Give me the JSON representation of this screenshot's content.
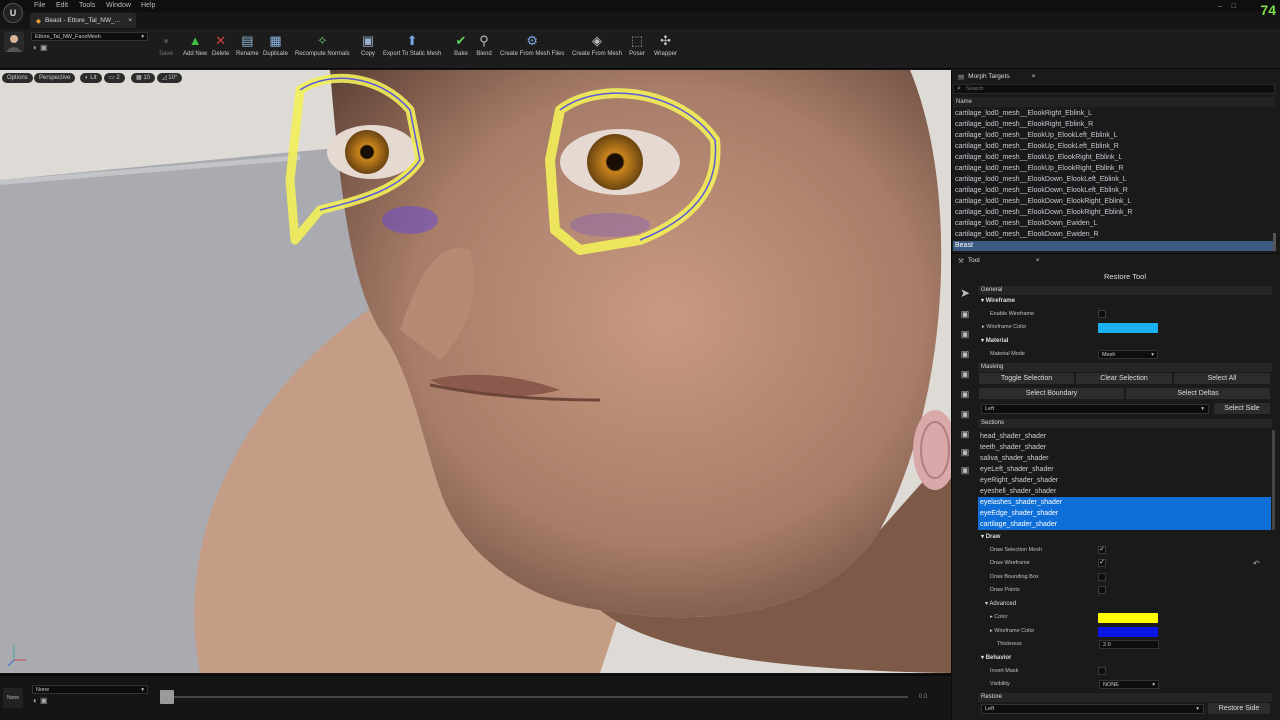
{
  "menu": [
    "File",
    "Edit",
    "Tools",
    "Window",
    "Help"
  ],
  "window": {
    "tab_title": "Beast - Ettore_Tal_NW_...",
    "fps": "74",
    "close": "×"
  },
  "toolbar": {
    "mesh_name": "Ettore_Tal_NW_FaceMesh",
    "buttons": [
      {
        "label": "Save",
        "icon": "▪"
      },
      {
        "label": "Add New",
        "icon": "▲"
      },
      {
        "label": "Delete",
        "icon": "✕"
      },
      {
        "label": "Rename",
        "icon": "▤"
      },
      {
        "label": "Duplicate",
        "icon": "▦"
      },
      {
        "label": "Recompute Normals",
        "icon": "✧"
      },
      {
        "label": "Copy",
        "icon": "▣"
      },
      {
        "label": "Export To Static Mesh",
        "icon": "⬆"
      },
      {
        "label": "Bake",
        "icon": "✔"
      },
      {
        "label": "Blend",
        "icon": "⚲"
      },
      {
        "label": "Create From Mesh Files",
        "icon": "⚙"
      },
      {
        "label": "Create From Mesh",
        "icon": "◈"
      },
      {
        "label": "Poser",
        "icon": "⬚"
      },
      {
        "label": "Wrapper",
        "icon": "✣"
      }
    ]
  },
  "viewport": {
    "options": "Options",
    "perspective": "Perspective",
    "lit": "Lit",
    "cam": "2",
    "grid": "10",
    "angle": "10°"
  },
  "timeline": {
    "track_select": "None",
    "small_label": "None",
    "time": "0.0"
  },
  "morph_panel": {
    "tab": "Morph Targets",
    "search_placeholder": "Search",
    "column": "Name",
    "rows": [
      "cartilage_lod0_mesh__ElookRight_Eblink_L",
      "cartilage_lod0_mesh__ElookRight_Eblink_R",
      "cartilage_lod0_mesh__ElookUp_ElookLeft_Eblink_L",
      "cartilage_lod0_mesh__ElookUp_ElookLeft_Eblink_R",
      "cartilage_lod0_mesh__ElookUp_ElookRight_Eblink_L",
      "cartilage_lod0_mesh__ElookUp_ElookRight_Eblink_R",
      "cartilage_lod0_mesh__ElookDown_ElookLeft_Eblink_L",
      "cartilage_lod0_mesh__ElookDown_ElookLeft_Eblink_R",
      "cartilage_lod0_mesh__ElookDown_ElookRight_Eblink_L",
      "cartilage_lod0_mesh__ElookDown_ElookRight_Eblink_R",
      "cartilage_lod0_mesh__ElookDown_Ewiden_L",
      "cartilage_lod0_mesh__ElookDown_Ewiden_R",
      "Beast"
    ]
  },
  "tool_panel": {
    "tab": "Tool",
    "title": "Restore Tool",
    "general": "General",
    "wireframe": {
      "header": "Wireframe",
      "enable_label": "Enable Wireframe",
      "color_label": "Wireframe Color",
      "color": "#1ab0f0"
    },
    "material": {
      "header": "Material",
      "mode_label": "Material Mode",
      "mode_value": "Mesh"
    },
    "masking": {
      "header": "Masking",
      "toggle": "Toggle Selection",
      "clear": "Clear Selection",
      "select_all": "Select All",
      "boundary": "Select Boundary",
      "deltas": "Select Deltas",
      "side_value": "Left",
      "select_side": "Select Side"
    },
    "sections": {
      "header": "Sections",
      "items": [
        "head_shader_shader",
        "teeth_shader_shader",
        "saliva_shader_shader",
        "eyeLeft_shader_shader",
        "eyeRight_shader_shader",
        "eyeshell_shader_shader",
        "eyelashes_shader_shader",
        "eyeEdge_shader_shader",
        "cartilage_shader_shader"
      ]
    },
    "draw": {
      "header": "Draw",
      "selection_mesh": "Draw Selection Mesh",
      "wireframe": "Draw Wireframe",
      "bounding_box": "Draw Bounding Box",
      "points": "Draw Points",
      "check": "✓",
      "reset": "↶"
    },
    "advanced": {
      "header": "Advanced",
      "color_label": "Color",
      "color": "#ffff00",
      "wire_color_label": "Wireframe Color",
      "wire_color": "#0a14e6",
      "thickness_label": "Thickness",
      "thickness": "2.0"
    },
    "behavior": {
      "header": "Behavior",
      "invert_mask": "Invert Mask",
      "visibility_label": "Visibility",
      "visibility_value": "NONE"
    },
    "restore": {
      "header": "Restore",
      "side_value": "Left",
      "button": "Restore Side"
    }
  }
}
